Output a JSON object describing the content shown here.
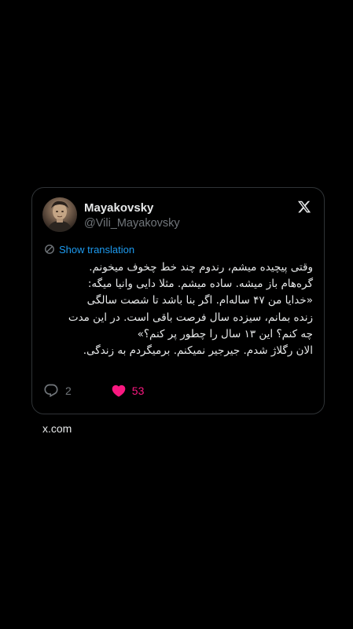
{
  "tweet": {
    "author": {
      "display_name": "Mayakovsky",
      "handle": "@Vili_Mayakovsky",
      "avatar": "avatar-photo"
    },
    "platform_icon": "x-logo-icon",
    "translate": {
      "icon": "translate-icon",
      "label": "Show translation"
    },
    "text_lines": [
      "وقتی پیچیده میشم، رندوم چند خط چخوف میخونم.",
      "گره‌هام باز میشه. ساده میشم. مثلا دایی وانیا میگه:",
      "«خدایا من ۴۷ ساله‌ام. اگر بنا باشد تا شصت سالگی",
      "زنده بمانم، سیزده سال فرصت باقی است. در این مدت",
      "چه کنم؟ این ۱۳ سال را چطور پر کنم؟»",
      "الان رگلاژ شدم. جیرجیر نمیکنم. برمیگردم به زندگی."
    ],
    "actions": {
      "reply": {
        "icon": "reply-icon",
        "count": "2"
      },
      "like": {
        "icon": "heart-icon",
        "count": "53",
        "liked": true
      }
    }
  },
  "source": "x.com",
  "colors": {
    "background": "#000000",
    "card_border": "#2f3336",
    "text_primary": "#e7e9ea",
    "text_secondary": "#71767b",
    "link": "#1d9bf0",
    "like": "#f91880"
  }
}
